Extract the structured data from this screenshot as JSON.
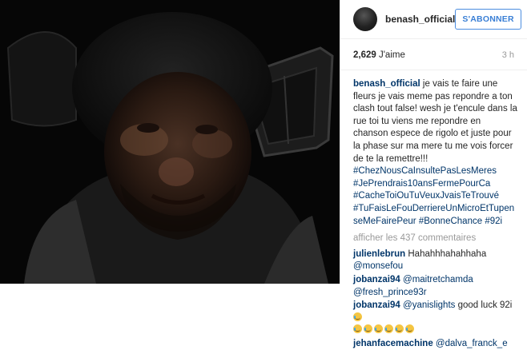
{
  "header": {
    "username": "benash_official",
    "follow_label": "S'ABONNER"
  },
  "meta": {
    "likes_count": "2,629",
    "likes_label": "J'aime",
    "time": "3 h"
  },
  "caption": {
    "username": "benash_official",
    "text": "je vais te faire une fleurs je vais meme pas repondre a ton clash tout false! wesh je t'encule dans la rue toi tu viens me repondre en chanson espece de rigolo et juste pour la phase sur ma mere tu me vois forcer de te la remettre!!!",
    "hashtags": [
      "#ChezNousCaInsultePasLesMeres",
      "#JePrendrais10ansFermePourCa",
      "#CacheToiOuTuVeuxJvaisTeTrouvé",
      "#TuFaisLeFouDerriereUnMicroEtTupenseMeFairePeur",
      "#BonneChance",
      "#92i"
    ]
  },
  "more_comments": "afficher les 437 commentaires",
  "comments": [
    {
      "user": "julienlebrun",
      "text": "Hahahhhahahhaha",
      "mention": "@monsefou"
    },
    {
      "user": "jobanzai94",
      "text": "",
      "mention": "@maitretchamda",
      "mention2": "@fresh_prince93r"
    },
    {
      "user": "jobanzai94",
      "text": "good luck 92i",
      "mention": "@yanislights",
      "emoji": "crying-laughing-face"
    },
    {
      "user": "jehanfacemachine",
      "text": "",
      "mention": "@dalva_franck_e"
    }
  ]
}
